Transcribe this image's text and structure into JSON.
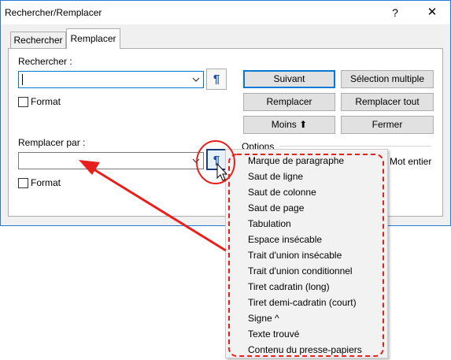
{
  "window": {
    "title": "Rechercher/Remplacer",
    "help_label": "?",
    "close_label": "✕"
  },
  "tabs": [
    {
      "label": "Rechercher",
      "selected": false
    },
    {
      "label": "Remplacer",
      "selected": true
    }
  ],
  "search": {
    "label": "Rechercher :",
    "value": "",
    "paragraph_button": "¶",
    "format_label": "Format",
    "format_checked": false
  },
  "replace": {
    "label": "Remplacer par :",
    "value": "",
    "paragraph_button": "¶",
    "format_label": "Format",
    "format_checked": false
  },
  "buttons": {
    "next": "Suivant",
    "multi_select": "Sélection multiple",
    "replace": "Remplacer",
    "replace_all": "Remplacer tout",
    "less": "Moins ⬆",
    "close": "Fermer"
  },
  "options": {
    "label": "Options",
    "whole_word_fragment": "Mot entier"
  },
  "special_menu": {
    "items": [
      "Marque de paragraphe",
      "Saut de ligne",
      "Saut de colonne",
      "Saut de page",
      "Tabulation",
      "Espace insécable",
      "Trait d'union insécable",
      "Trait d'union conditionnel",
      "Tiret cadratin (long)",
      "Tiret demi-cadratin (court)",
      "Signe ^",
      "Texte trouvé",
      "Contenu du presse-papiers"
    ]
  },
  "colors": {
    "accent": "#0078d7",
    "annotation": "#e8201d"
  }
}
